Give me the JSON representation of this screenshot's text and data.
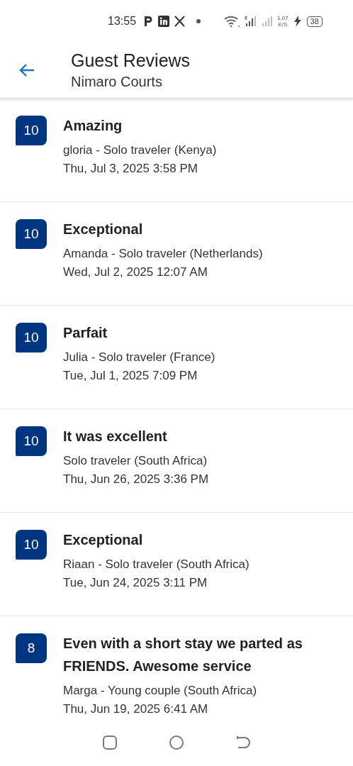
{
  "status_bar": {
    "time": "13:55",
    "speed_value": "1.07",
    "speed_unit": "K/S",
    "battery": "38"
  },
  "header": {
    "title": "Guest Reviews",
    "subtitle": "Nimaro Courts"
  },
  "reviews": [
    {
      "score": "10",
      "title": "Amazing",
      "reviewer": "gloria - Solo traveler (Kenya)",
      "date": "Thu, Jul 3, 2025 3:58 PM"
    },
    {
      "score": "10",
      "title": "Exceptional",
      "reviewer": "Amanda - Solo traveler (Netherlands)",
      "date": "Wed, Jul 2, 2025 12:07 AM"
    },
    {
      "score": "10",
      "title": "Parfait",
      "reviewer": "Julia - Solo traveler (France)",
      "date": "Tue, Jul 1, 2025 7:09 PM"
    },
    {
      "score": "10",
      "title": "It was excellent",
      "reviewer": "Solo traveler (South Africa)",
      "date": "Thu, Jun 26, 2025 3:36 PM"
    },
    {
      "score": "10",
      "title": "Exceptional",
      "reviewer": "Riaan - Solo traveler (South Africa)",
      "date": "Tue, Jun 24, 2025 3:11 PM"
    },
    {
      "score": "8",
      "title": "Even with a short stay we parted as FRIENDS. Awesome service",
      "reviewer": "Marga - Young couple (South Africa)",
      "date": "Thu, Jun 19, 2025 6:41 AM"
    }
  ]
}
